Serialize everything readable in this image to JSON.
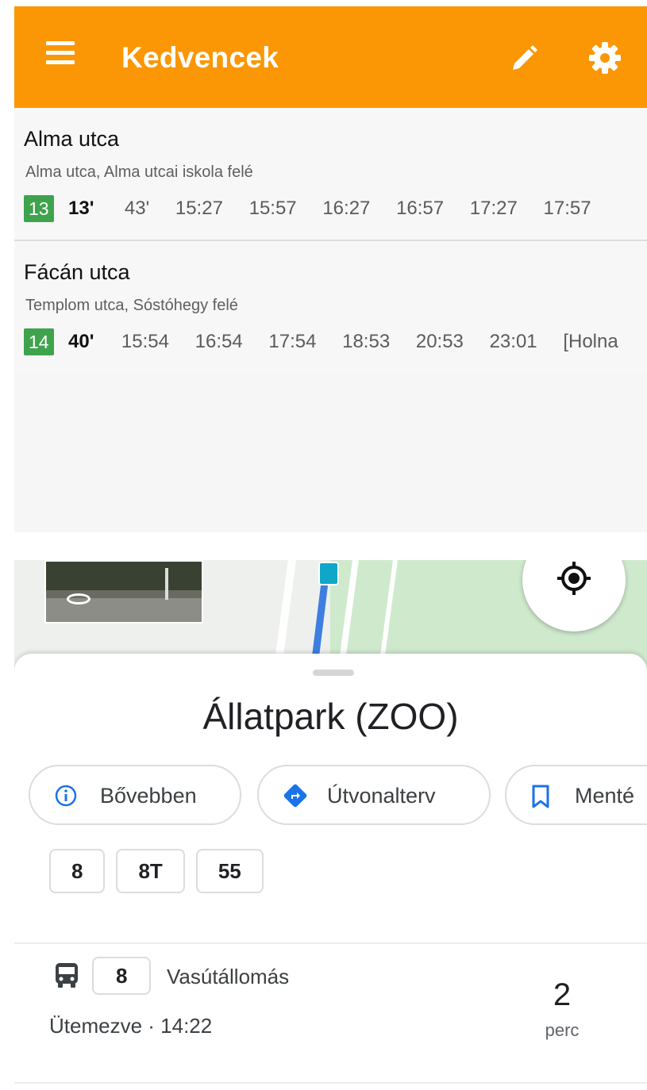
{
  "top": {
    "app_title": "Kedvencek",
    "icons": {
      "menu": "menu-icon",
      "edit": "pencil-icon",
      "settings": "gear-icon"
    },
    "colors": {
      "appbar": "#fb9704",
      "route_badge": "#3fa34d"
    },
    "favorites": [
      {
        "name": "Alma utca",
        "subtitle": "Alma utca, Alma utcai iskola felé",
        "route": "13",
        "first_time": "13'",
        "times": [
          "43'",
          "15:27",
          "15:57",
          "16:27",
          "16:57",
          "17:27",
          "17:57"
        ]
      },
      {
        "name": "Fácán utca",
        "subtitle": "Templom utca, Sóstóhegy felé",
        "route": "14",
        "first_time": "40'",
        "times": [
          "15:54",
          "16:54",
          "17:54",
          "18:53",
          "20:53",
          "23:01",
          "[Holna"
        ]
      }
    ]
  },
  "maps": {
    "place_title": "Állatpark (ZOO)",
    "actions": [
      {
        "label": "Bővebben",
        "icon": "info-icon"
      },
      {
        "label": "Útvonalterv",
        "icon": "directions-icon"
      },
      {
        "label": "Menté",
        "icon": "bookmark-icon"
      }
    ],
    "lines": [
      "8",
      "8T",
      "55"
    ],
    "departure": {
      "icon": "bus-icon",
      "line": "8",
      "destination": "Vasútállomás",
      "schedule": "Ütemezve · 14:22",
      "minutes": "2",
      "unit": "perc"
    }
  }
}
